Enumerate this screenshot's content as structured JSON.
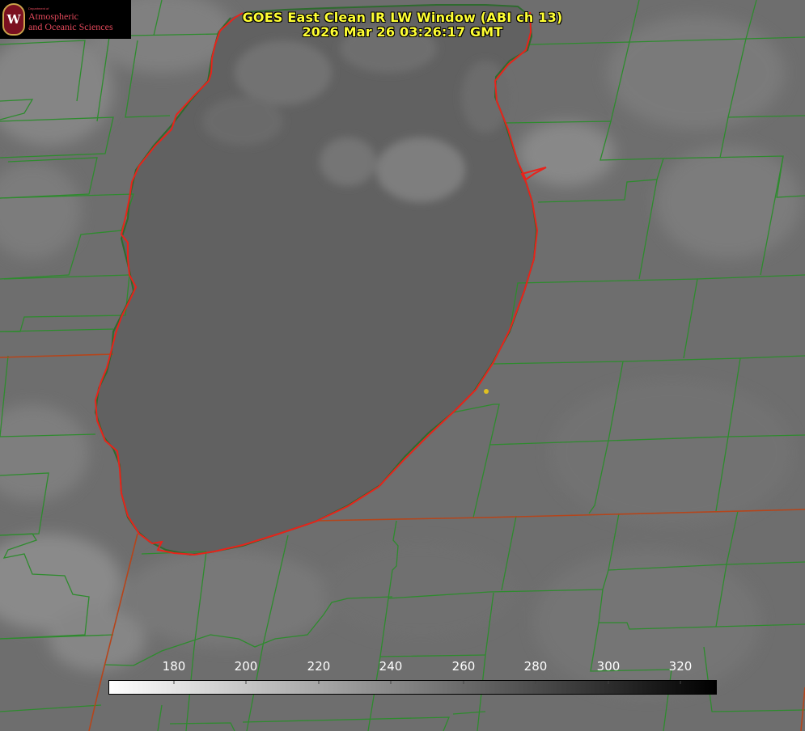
{
  "title": {
    "line1": "GOES East Clean IR LW Window (ABI ch 13)",
    "line2": "2026 Mar 26 03:26:17 GMT"
  },
  "logo": {
    "department": "Department of",
    "name_line1": "Atmospheric",
    "name_line2": "and Oceanic Sciences",
    "seal_letter": "W"
  },
  "colorbar": {
    "ticks": [
      "180",
      "200",
      "220",
      "240",
      "260",
      "280",
      "300",
      "320"
    ],
    "color_start": "#ffffff",
    "color_end": "#000000"
  },
  "colors": {
    "background_gray": "#6d6d6d",
    "lake_gray": "#5f5f5f",
    "county_lines": "#2e8b2e",
    "state_lines": "#b5451b",
    "shoreline": "#e8231b",
    "title_text": "#ffff33",
    "marker": "#e0c020"
  }
}
